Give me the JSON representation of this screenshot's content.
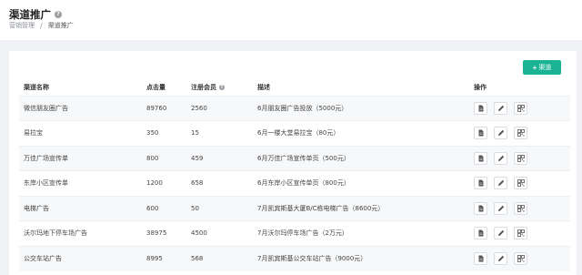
{
  "header": {
    "title": "渠道推广",
    "breadcrumb": {
      "parent": "营销管理",
      "separator": "/",
      "current": "渠道推广"
    }
  },
  "toolbar": {
    "add_label": "渠道"
  },
  "table": {
    "columns": {
      "name": "渠道名称",
      "clicks": "点击量",
      "members": "注册会员",
      "desc": "描述",
      "ops": "操作"
    },
    "rows": [
      {
        "name": "微信朋友圈广告",
        "clicks": "89760",
        "members": "2560",
        "desc": "6月朋友圈广告投放（5000元）"
      },
      {
        "name": "易拉宝",
        "clicks": "350",
        "members": "15",
        "desc": "6月一楼大堂易拉宝（80元）"
      },
      {
        "name": "万佳广场宣传单",
        "clicks": "800",
        "members": "459",
        "desc": "6月万佳广场宣传单页（500元）"
      },
      {
        "name": "东岸小区宣传单",
        "clicks": "1200",
        "members": "658",
        "desc": "6月东岸小区宣传单页（800元）"
      },
      {
        "name": "电梯广告",
        "clicks": "600",
        "members": "50",
        "desc": "7月凯宾斯基大厦B/C栋电梯广告（8600元）"
      },
      {
        "name": "沃尔玛地下停车场广告",
        "clicks": "38975",
        "members": "4500",
        "desc": "7月沃尔玛停车场广告（2万元）"
      },
      {
        "name": "公交车站广告",
        "clicks": "8995",
        "members": "568",
        "desc": "7月凯宾斯基公交车站广告（9000元）"
      }
    ]
  },
  "icons": {
    "view": "document-icon",
    "edit": "pencil-icon",
    "qr": "qrcode-icon"
  },
  "colors": {
    "accent": "#1ab394"
  }
}
